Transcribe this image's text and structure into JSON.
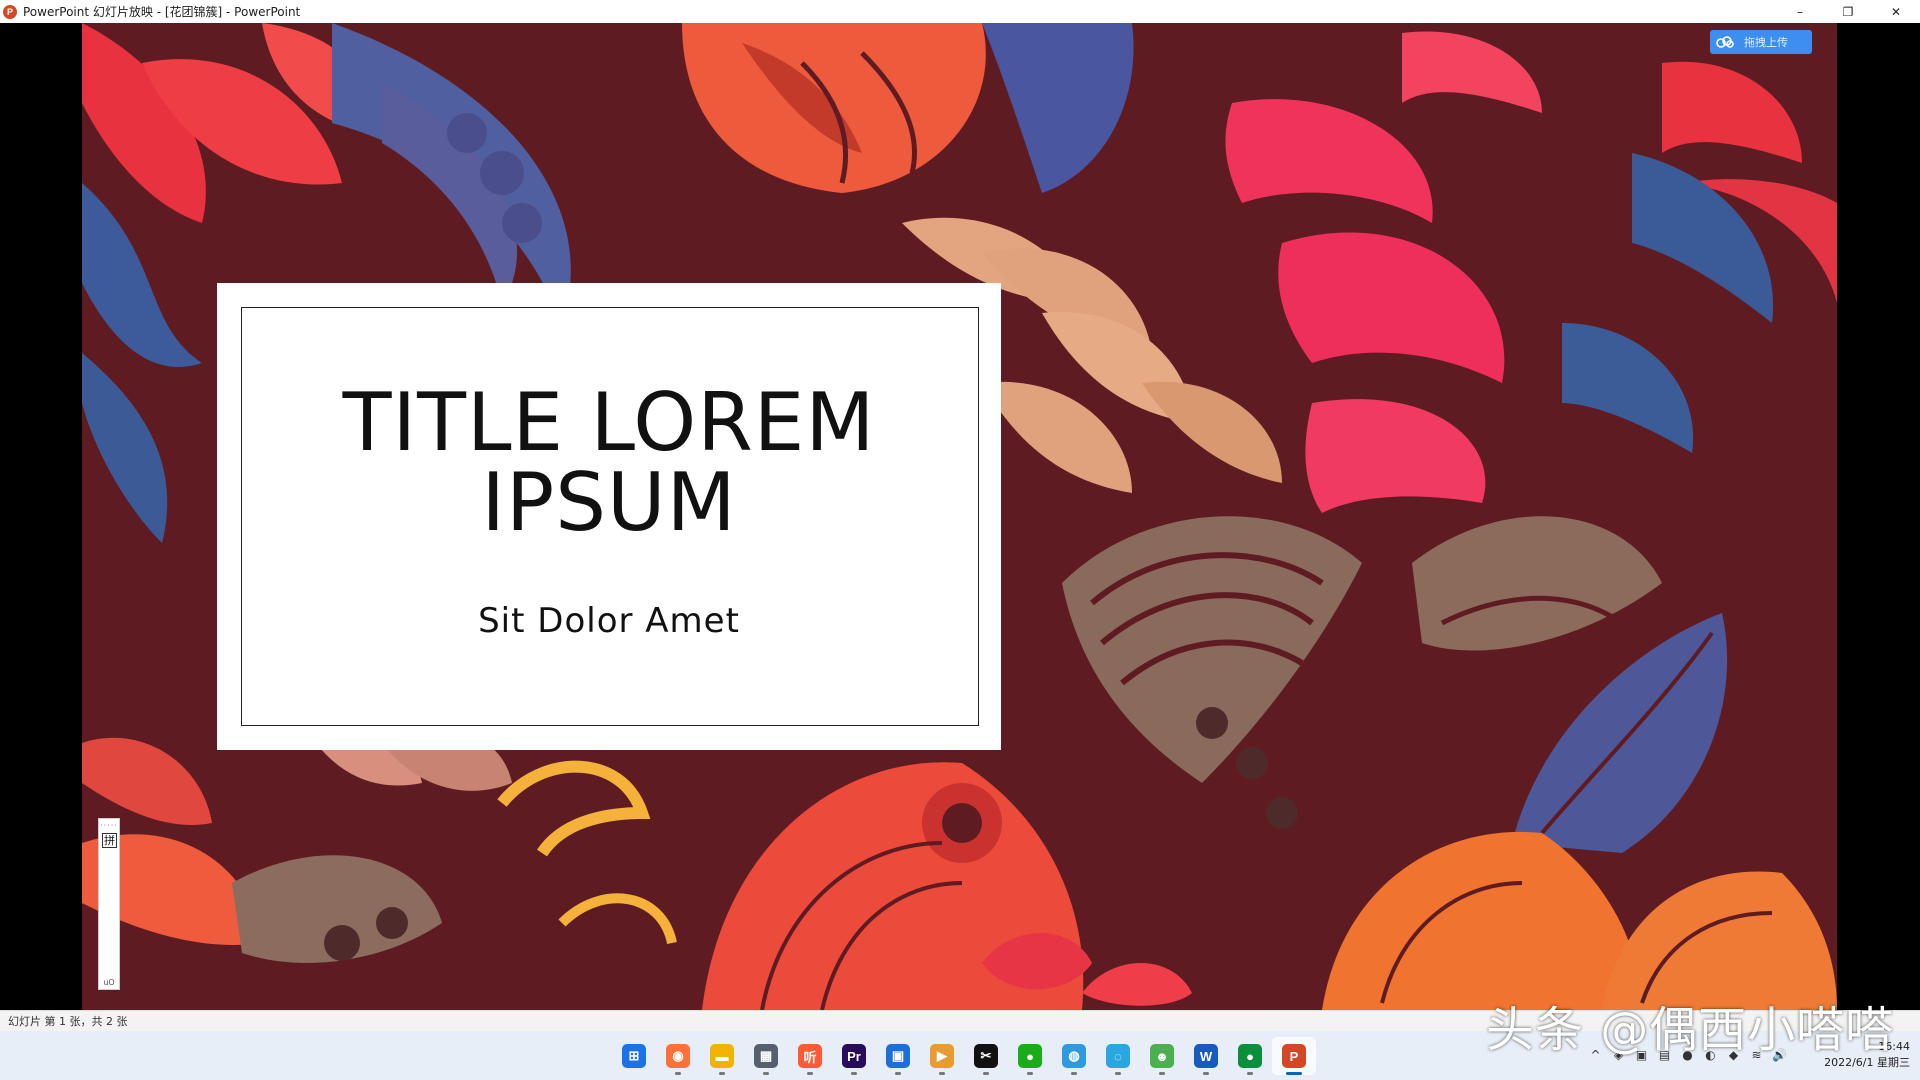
{
  "window": {
    "icon_label": "P",
    "title": "PowerPoint 幻灯片放映 - [花团锦簇] - PowerPoint",
    "minimize": "–",
    "restore": "❐",
    "close": "✕"
  },
  "slide": {
    "title": "TITLE LOREM IPSUM",
    "subtitle": "Sit Dolor Amet"
  },
  "upload_button": {
    "icon": "cloud-icon",
    "label": "拖拽上传"
  },
  "ime_toolbar": {
    "dots": "·····",
    "mode": "拼",
    "footer": "uO"
  },
  "statusbar": {
    "slide_count": "幻灯片 第 1 张，共 2 张"
  },
  "taskbar": {
    "apps": [
      {
        "name": "windows-start",
        "glyph": "⊞",
        "color": "#1a73e8"
      },
      {
        "name": "firefox",
        "glyph": "◉",
        "color": "#ff7139"
      },
      {
        "name": "file-explorer",
        "glyph": "▬",
        "color": "#f0b400"
      },
      {
        "name": "calculator",
        "glyph": "▦",
        "color": "#555f6d"
      },
      {
        "name": "listen-app",
        "glyph": "听",
        "color": "#ff5a36"
      },
      {
        "name": "premiere-pro",
        "glyph": "Pr",
        "color": "#2a0a5a"
      },
      {
        "name": "meeting-app",
        "glyph": "▣",
        "color": "#1c6fd8"
      },
      {
        "name": "video-player",
        "glyph": "▶",
        "color": "#e89b2f"
      },
      {
        "name": "capcut",
        "glyph": "✂",
        "color": "#111111"
      },
      {
        "name": "wechat",
        "glyph": "●",
        "color": "#1aad19"
      },
      {
        "name": "browser-globe",
        "glyph": "◍",
        "color": "#2f9ae0"
      },
      {
        "name": "search-app",
        "glyph": "◌",
        "color": "#2aa7e0"
      },
      {
        "name": "green-app",
        "glyph": "☻",
        "color": "#4caf50"
      },
      {
        "name": "word",
        "glyph": "W",
        "color": "#185abd"
      },
      {
        "name": "chat-app",
        "glyph": "●",
        "color": "#0b8f3c"
      },
      {
        "name": "powerpoint",
        "glyph": "P",
        "color": "#d24726"
      }
    ],
    "tray": [
      "^",
      "◈",
      "▣",
      "▤",
      "●",
      "◐",
      "◆",
      "≋",
      "🔊"
    ],
    "time": "16:44",
    "date": "2022/6/1 星期三"
  },
  "watermark": "头条 @偶西小嗒嗒"
}
